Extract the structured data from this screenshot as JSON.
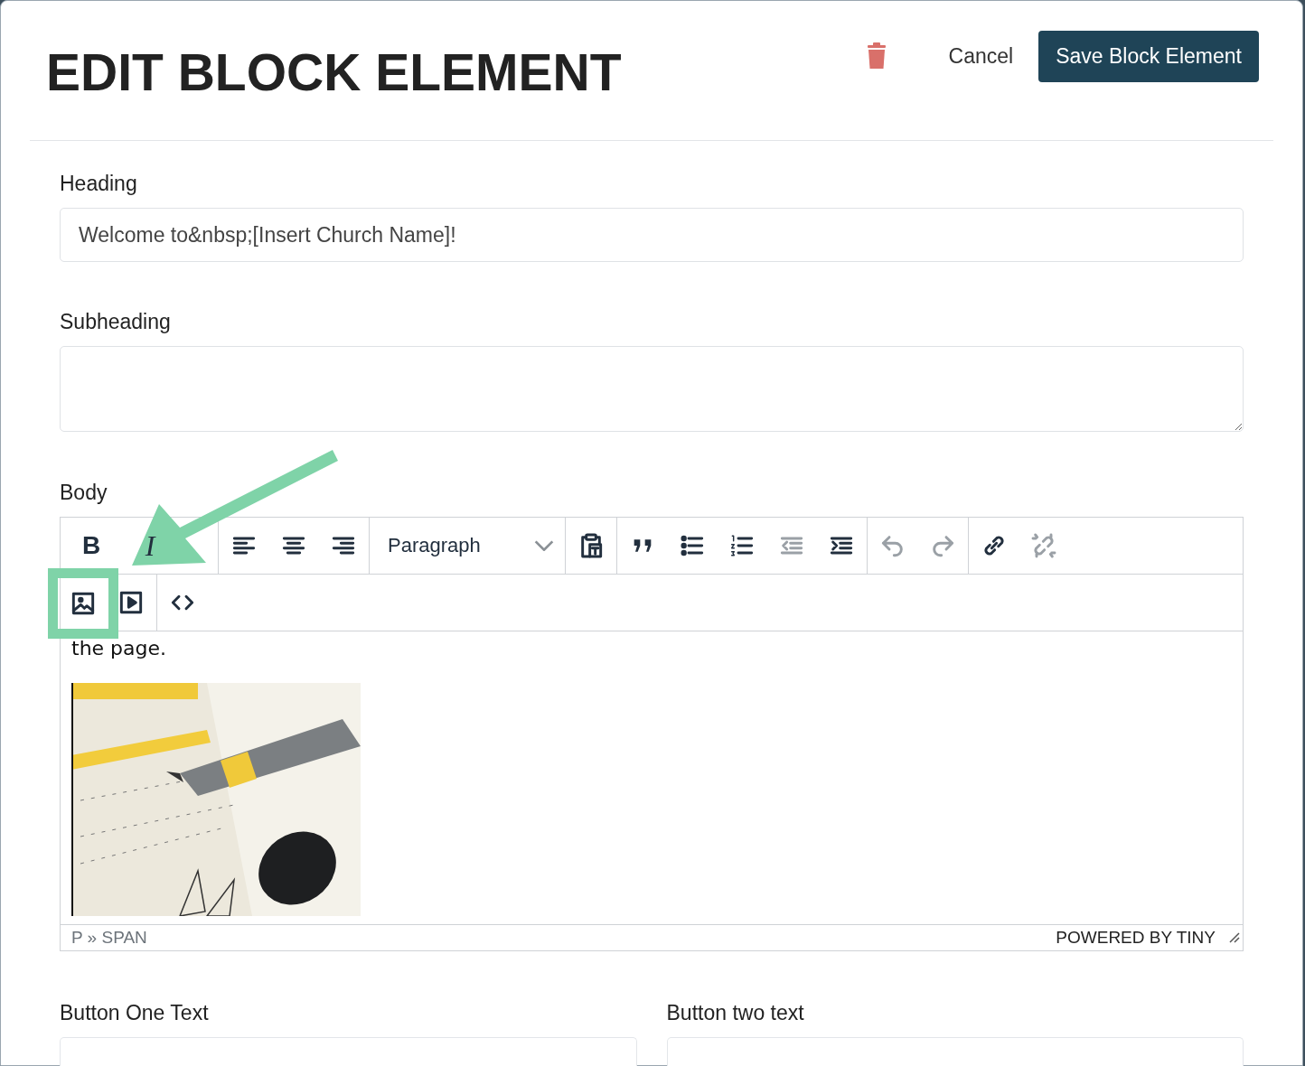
{
  "dialog": {
    "title": "EDIT BLOCK ELEMENT",
    "actions": [
      {
        "kind": "delete"
      },
      {
        "kind": "cancel",
        "label": "Cancel"
      },
      {
        "kind": "save",
        "label": "Save Block Element"
      }
    ]
  },
  "fields": [
    {
      "kind": "input",
      "label": "Heading",
      "value": "Welcome to&nbsp;[Insert Church Name]!"
    },
    {
      "kind": "textarea",
      "label": "Subheading"
    }
  ],
  "editor": {
    "label": "Body",
    "toolbar_rows": [
      [
        [
          {
            "kind": "text",
            "label": "B",
            "disabled": false,
            "highlighted": false
          },
          {
            "kind": "text",
            "label": "I",
            "disabled": false,
            "highlighted": false
          }
        ],
        [
          {
            "kind": "icon",
            "disabled": false,
            "highlighted": false
          },
          {
            "kind": "icon",
            "disabled": false,
            "highlighted": false
          },
          {
            "kind": "icon",
            "disabled": false,
            "highlighted": false
          }
        ],
        [
          {
            "kind": "select",
            "label": "Paragraph",
            "disabled": false,
            "highlighted": false
          }
        ],
        [
          {
            "kind": "icon",
            "disabled": false,
            "highlighted": false
          }
        ],
        [
          {
            "kind": "icon",
            "disabled": false,
            "highlighted": false
          },
          {
            "kind": "icon",
            "disabled": false,
            "highlighted": false
          },
          {
            "kind": "icon",
            "disabled": false,
            "highlighted": false
          },
          {
            "kind": "icon",
            "disabled": true,
            "highlighted": false
          },
          {
            "kind": "icon",
            "disabled": false,
            "highlighted": false
          }
        ],
        [
          {
            "kind": "icon",
            "disabled": true,
            "highlighted": false
          },
          {
            "kind": "icon",
            "disabled": true,
            "highlighted": false
          }
        ],
        [
          {
            "kind": "icon",
            "disabled": false,
            "highlighted": false
          },
          {
            "kind": "icon",
            "disabled": true,
            "highlighted": false
          }
        ]
      ],
      [
        [
          {
            "kind": "icon",
            "disabled": false,
            "highlighted": true
          },
          {
            "kind": "icon",
            "disabled": false,
            "highlighted": false
          }
        ],
        [
          {
            "kind": "icon",
            "disabled": false,
            "highlighted": false
          }
        ]
      ]
    ],
    "content": [
      {
        "kind": "text",
        "text": "the page."
      },
      {
        "kind": "picture"
      }
    ],
    "path": "P » SPAN",
    "branding": "POWERED BY TINY"
  },
  "bottom_fields": [
    {
      "label": "Button One Text"
    },
    {
      "label": "Button two text"
    }
  ]
}
